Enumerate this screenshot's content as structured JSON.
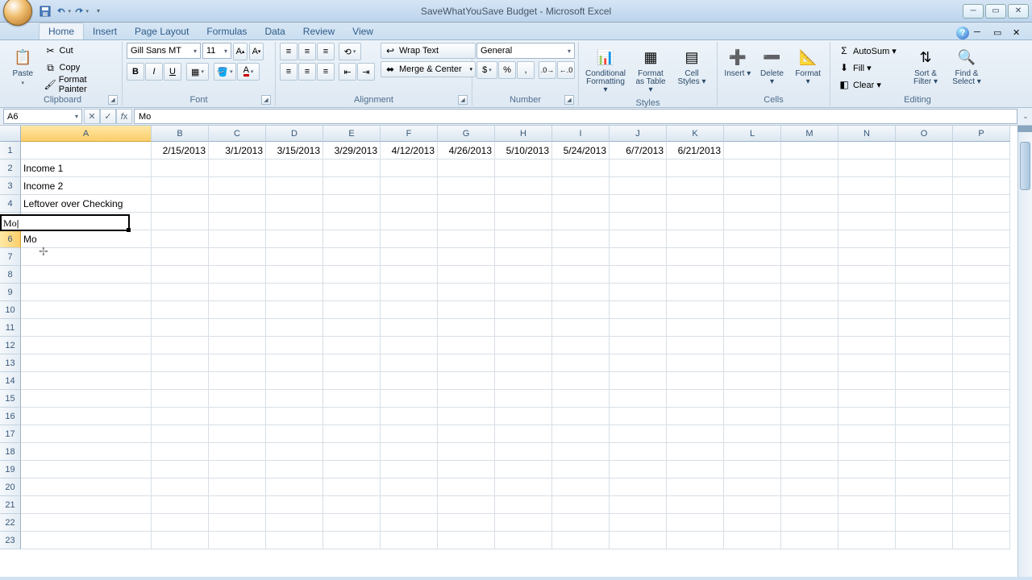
{
  "app": {
    "title": "SaveWhatYouSave Budget - Microsoft Excel"
  },
  "qat": {
    "save": "save-icon",
    "undo": "undo-icon",
    "redo": "redo-icon"
  },
  "tabs": [
    "Home",
    "Insert",
    "Page Layout",
    "Formulas",
    "Data",
    "Review",
    "View"
  ],
  "active_tab": "Home",
  "ribbon": {
    "clipboard": {
      "label": "Clipboard",
      "paste": "Paste",
      "cut": "Cut",
      "copy": "Copy",
      "format_painter": "Format Painter"
    },
    "font": {
      "label": "Font",
      "name": "Gill Sans MT",
      "size": "11"
    },
    "alignment": {
      "label": "Alignment",
      "wrap": "Wrap Text",
      "merge": "Merge & Center"
    },
    "number": {
      "label": "Number",
      "format": "General"
    },
    "styles": {
      "label": "Styles",
      "conditional": "Conditional Formatting ▾",
      "table": "Format as Table ▾",
      "cell": "Cell Styles ▾"
    },
    "cells": {
      "label": "Cells",
      "insert": "Insert ▾",
      "delete": "Delete ▾",
      "format": "Format ▾"
    },
    "editing": {
      "label": "Editing",
      "autosum": "AutoSum ▾",
      "fill": "Fill ▾",
      "clear": "Clear ▾",
      "sort": "Sort & Filter ▾",
      "find": "Find & Select ▾"
    }
  },
  "formula_bar": {
    "cell_ref": "A6",
    "content": "Mo"
  },
  "grid": {
    "columns": [
      "A",
      "B",
      "C",
      "D",
      "E",
      "F",
      "G",
      "H",
      "I",
      "J",
      "K",
      "L",
      "M",
      "N",
      "O",
      "P"
    ],
    "col_widths": {
      "A": 162
    },
    "default_col_width": 71,
    "rows": 23,
    "active_cell": "A6",
    "data": {
      "1": {
        "B": "2/15/2013",
        "C": "3/1/2013",
        "D": "3/15/2013",
        "E": "3/29/2013",
        "F": "4/12/2013",
        "G": "4/26/2013",
        "H": "5/10/2013",
        "I": "5/24/2013",
        "J": "6/7/2013",
        "K": "6/21/2013"
      },
      "2": {
        "A": "Income 1"
      },
      "3": {
        "A": "Income 2"
      },
      "4": {
        "A": "Leftover over Checking"
      },
      "6": {
        "A": "Mo"
      }
    }
  }
}
